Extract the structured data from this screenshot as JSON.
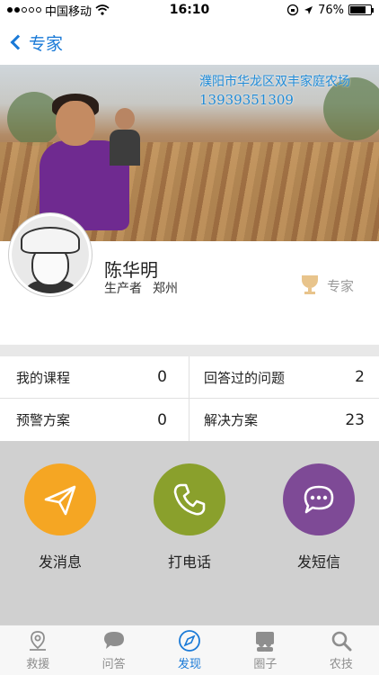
{
  "status_bar": {
    "carrier": "中国移动",
    "time": "16:10",
    "battery": "76%",
    "battery_level": 0.76
  },
  "nav": {
    "back_label": "专家"
  },
  "banner": {
    "title": "濮阳市华龙区双丰家庭农场",
    "phone": "13939351309"
  },
  "profile": {
    "name": "陈华明",
    "role": "生产者",
    "location": "郑州",
    "badge_label": "专家"
  },
  "stats": [
    {
      "label": "我的课程",
      "value": "0"
    },
    {
      "label": "回答过的问题",
      "value": "2"
    },
    {
      "label": "预警方案",
      "value": "0"
    },
    {
      "label": "解决方案",
      "value": "23"
    }
  ],
  "actions": [
    {
      "label": "发消息",
      "icon": "paper-plane-icon",
      "color": "#f5a623"
    },
    {
      "label": "打电话",
      "icon": "phone-icon",
      "color": "#8aa02c"
    },
    {
      "label": "发短信",
      "icon": "chat-bubble-icon",
      "color": "#7e4a96"
    }
  ],
  "tabs": [
    {
      "label": "救援",
      "icon": "location-pin-icon",
      "active": false
    },
    {
      "label": "问答",
      "icon": "speech-bubble-icon",
      "active": false
    },
    {
      "label": "发现",
      "icon": "compass-icon",
      "active": true
    },
    {
      "label": "圈子",
      "icon": "people-icon",
      "active": false
    },
    {
      "label": "农技",
      "icon": "search-icon",
      "active": false
    }
  ],
  "colors": {
    "accent": "#1a7ad7",
    "banner_text": "#1f8ad6",
    "action_area_bg": "#d0d0d0"
  }
}
